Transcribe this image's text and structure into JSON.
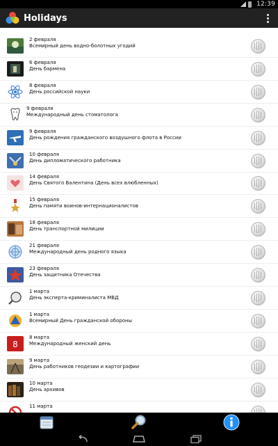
{
  "status": {
    "time": "12:39"
  },
  "app": {
    "title": "Holidays"
  },
  "holidays": [
    {
      "date": "2 февраля",
      "name": "Всемирный день водно-болотных угодий",
      "icon": "wetlands-photo-icon"
    },
    {
      "date": "6 февраля",
      "name": "День бармена",
      "icon": "bartender-photo-icon"
    },
    {
      "date": "8 февраля",
      "name": "День российской науки",
      "icon": "atom-icon"
    },
    {
      "date": "9 февраля",
      "name": "Международный день стоматолога",
      "icon": "tooth-icon"
    },
    {
      "date": "9 февраля",
      "name": "День рождения гражданского воздушного флота в России",
      "icon": "aeroflot-icon"
    },
    {
      "date": "10 февраля",
      "name": "День дипломатического работника",
      "icon": "diplomat-emblem-icon"
    },
    {
      "date": "14 февраля",
      "name": "День Святого Валентина (День всех влюбленных)",
      "icon": "valentine-hearts-icon"
    },
    {
      "date": "15 февраля",
      "name": "День памяти воинов-интернационалистов",
      "icon": "military-medal-icon"
    },
    {
      "date": "18 февраля",
      "name": "День транспортной милиции",
      "icon": "transport-police-photo-icon"
    },
    {
      "date": "21 февраля",
      "name": "Международный день родного языка",
      "icon": "un-emblem-icon"
    },
    {
      "date": "23 февраля",
      "name": "День защитника Отечества",
      "icon": "defender-star-icon"
    },
    {
      "date": "1 марта",
      "name": "День эксперта-криминалиста МВД",
      "icon": "magnifier-emblem-icon"
    },
    {
      "date": "1 марта",
      "name": "Всемирный День гражданской обороны",
      "icon": "civil-defense-icon"
    },
    {
      "date": "8 марта",
      "name": "Международный женский день",
      "icon": "womens-day-icon"
    },
    {
      "date": "9 марта",
      "name": "День работников геодезии и картографии",
      "icon": "geodesy-photo-icon"
    },
    {
      "date": "10 марта",
      "name": "День архивов",
      "icon": "archive-books-icon"
    },
    {
      "date": "11 марта",
      "name": "",
      "icon": "no-drugs-icon"
    }
  ],
  "row_action_icon": "wikipedia-globe-icon",
  "bottom_tabs": [
    {
      "icon": "calendar-icon"
    },
    {
      "icon": "search-icon"
    },
    {
      "icon": "info-icon"
    }
  ],
  "navigation": [
    "back-icon",
    "home-icon",
    "recent-apps-icon"
  ],
  "colors": {
    "action_bar": "#222222",
    "list_bg": "#ffffff",
    "info_blue": "#1e90ff"
  }
}
